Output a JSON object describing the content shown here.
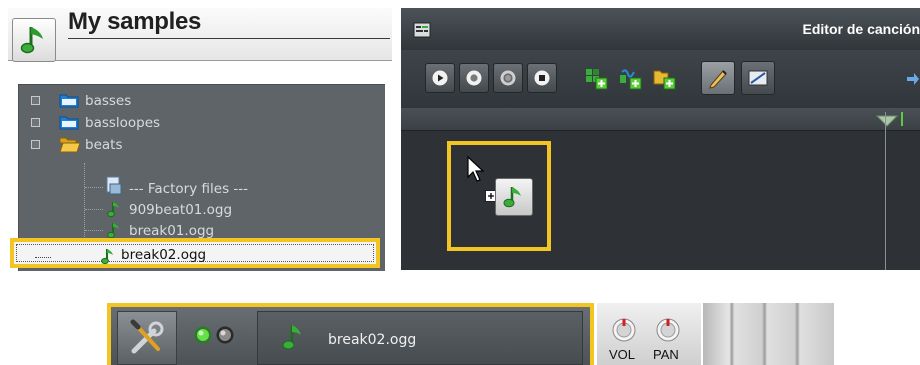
{
  "samples_panel": {
    "title": "My samples",
    "tree": [
      {
        "label": "basses",
        "kind": "folder-closed"
      },
      {
        "label": "bassloopes",
        "kind": "folder-closed"
      },
      {
        "label": "beats",
        "kind": "folder-open"
      },
      {
        "label": "--- Factory files ---",
        "kind": "factory-file"
      },
      {
        "label": "909beat01.ogg",
        "kind": "sample"
      },
      {
        "label": "break01.ogg",
        "kind": "sample"
      },
      {
        "label": "break02.ogg",
        "kind": "sample",
        "selected": true
      }
    ]
  },
  "song_editor": {
    "title": "Editor de canción",
    "toolbar": [
      "play-icon",
      "record-icon",
      "record-while-playing-icon",
      "stop-icon",
      "add-beat-bassline-icon",
      "add-sample-track-icon",
      "add-automation-track-icon",
      "draw-mode-icon",
      "edit-mode-icon"
    ]
  },
  "track": {
    "name": "break02.ogg",
    "vol_label": "VOL",
    "pan_label": "PAN"
  },
  "colors": {
    "highlight": "#f3c522",
    "panel_dark": "#2c3034"
  }
}
